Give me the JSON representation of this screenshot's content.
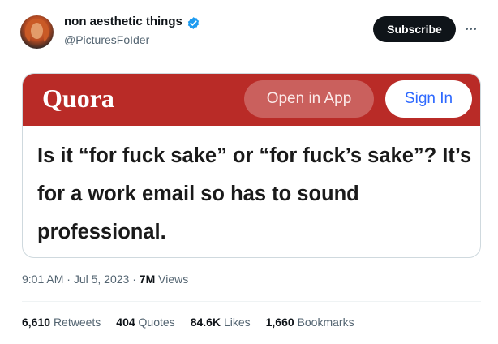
{
  "author": {
    "name": "non aesthetic things",
    "handle": "@PicturesFoIder"
  },
  "header": {
    "subscribe_label": "Subscribe"
  },
  "embed": {
    "logo_text": "Quora",
    "open_in_app_label": "Open in App",
    "sign_in_label": "Sign In",
    "question": "Is it “for fuck sake” or “for fuck’s sake”? It’s for a work email so has to sound professional."
  },
  "meta": {
    "time": "9:01 AM",
    "sep1": " · ",
    "date": "Jul 5, 2023",
    "sep2": " · ",
    "views_count": "7M",
    "views_label": " Views"
  },
  "stats": [
    {
      "count": "6,610",
      "label": "Retweets"
    },
    {
      "count": "404",
      "label": "Quotes"
    },
    {
      "count": "84.6K",
      "label": "Likes"
    },
    {
      "count": "1,660",
      "label": "Bookmarks"
    }
  ],
  "colors": {
    "quora_red": "#b92b27",
    "verified_blue": "#1d9bf0",
    "sign_in_blue": "#2e69ff"
  }
}
